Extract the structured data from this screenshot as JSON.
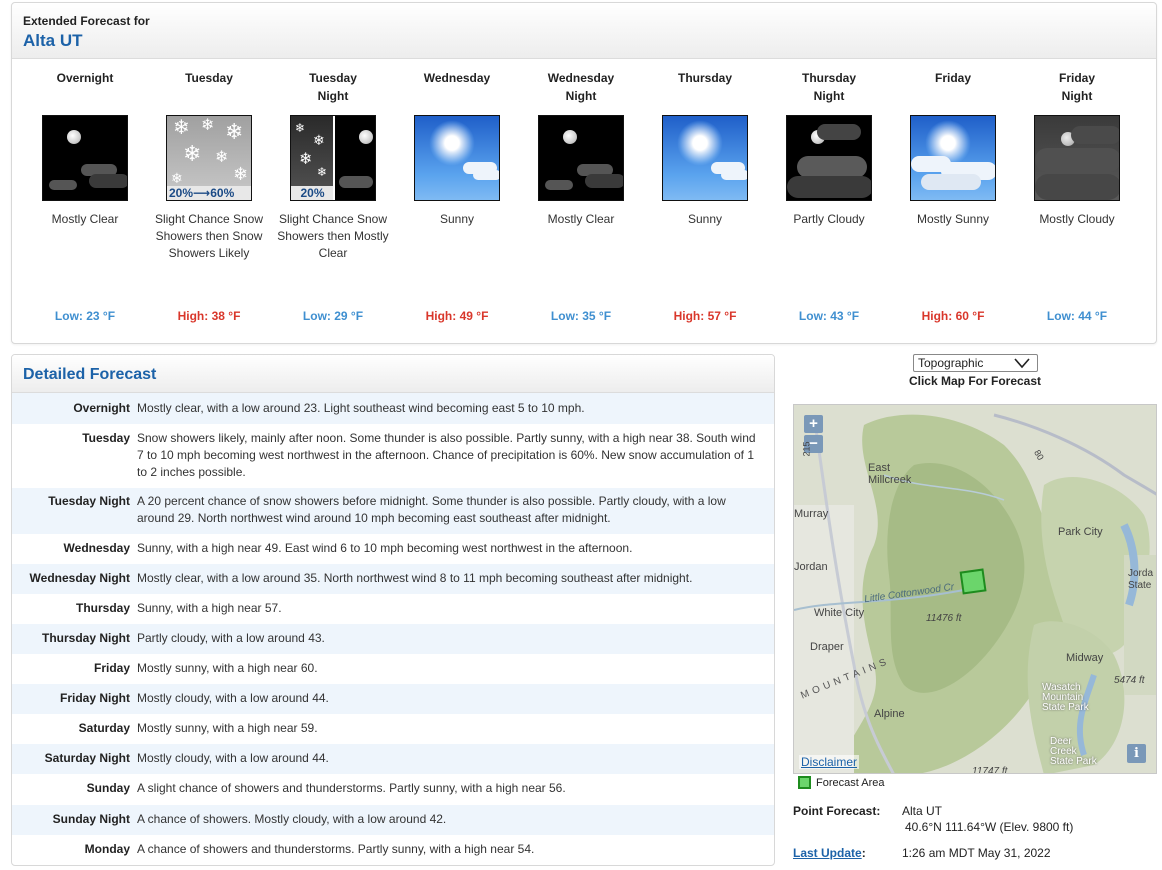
{
  "extended": {
    "subtitle": "Extended Forecast for",
    "location": "Alta UT",
    "periods": [
      {
        "name_line1": "Overnight",
        "name_line2": "",
        "short_desc": "Mostly Clear",
        "temp": "Low: 23 °F",
        "temp_type": "low",
        "icon": "night-clear-icon",
        "pop_label": ""
      },
      {
        "name_line1": "Tuesday",
        "name_line2": "",
        "short_desc": "Slight Chance Snow Showers then Snow Showers Likely",
        "temp": "High: 38 °F",
        "temp_type": "high",
        "icon": "snow-showers-icon",
        "pop_label": "20%⟶60%"
      },
      {
        "name_line1": "Tuesday",
        "name_line2": "Night",
        "short_desc": "Slight Chance Snow Showers then Mostly Clear",
        "temp": "Low: 29 °F",
        "temp_type": "low",
        "icon": "snow-then-clear-night-icon",
        "pop_label": "20%"
      },
      {
        "name_line1": "Wednesday",
        "name_line2": "",
        "short_desc": "Sunny",
        "temp": "High: 49 °F",
        "temp_type": "high",
        "icon": "sunny-icon",
        "pop_label": ""
      },
      {
        "name_line1": "Wednesday",
        "name_line2": "Night",
        "short_desc": "Mostly Clear",
        "temp": "Low: 35 °F",
        "temp_type": "low",
        "icon": "night-clear-icon",
        "pop_label": ""
      },
      {
        "name_line1": "Thursday",
        "name_line2": "",
        "short_desc": "Sunny",
        "temp": "High: 57 °F",
        "temp_type": "high",
        "icon": "sunny-icon",
        "pop_label": ""
      },
      {
        "name_line1": "Thursday",
        "name_line2": "Night",
        "short_desc": "Partly Cloudy",
        "temp": "Low: 43 °F",
        "temp_type": "low",
        "icon": "night-partly-cloudy-icon",
        "pop_label": ""
      },
      {
        "name_line1": "Friday",
        "name_line2": "",
        "short_desc": "Mostly Sunny",
        "temp": "High: 60 °F",
        "temp_type": "high",
        "icon": "mostly-sunny-icon",
        "pop_label": ""
      },
      {
        "name_line1": "Friday",
        "name_line2": "Night",
        "short_desc": "Mostly Cloudy",
        "temp": "Low: 44 °F",
        "temp_type": "low",
        "icon": "night-mostly-cloudy-icon",
        "pop_label": ""
      }
    ]
  },
  "detailed": {
    "title": "Detailed Forecast",
    "rows": [
      {
        "label": "Overnight",
        "text": "Mostly clear, with a low around 23. Light southeast wind becoming east 5 to 10 mph."
      },
      {
        "label": "Tuesday",
        "text": "Snow showers likely, mainly after noon. Some thunder is also possible. Partly sunny, with a high near 38. South wind 7 to 10 mph becoming west northwest in the afternoon. Chance of precipitation is 60%. New snow accumulation of 1 to 2 inches possible."
      },
      {
        "label": "Tuesday Night",
        "text": "A 20 percent chance of snow showers before midnight. Some thunder is also possible. Partly cloudy, with a low around 29. North northwest wind around 10 mph becoming east southeast after midnight."
      },
      {
        "label": "Wednesday",
        "text": "Sunny, with a high near 49. East wind 6 to 10 mph becoming west northwest in the afternoon."
      },
      {
        "label": "Wednesday Night",
        "text": "Mostly clear, with a low around 35. North northwest wind 8 to 11 mph becoming southeast after midnight."
      },
      {
        "label": "Thursday",
        "text": "Sunny, with a high near 57."
      },
      {
        "label": "Thursday Night",
        "text": "Partly cloudy, with a low around 43."
      },
      {
        "label": "Friday",
        "text": "Mostly sunny, with a high near 60."
      },
      {
        "label": "Friday Night",
        "text": "Mostly cloudy, with a low around 44."
      },
      {
        "label": "Saturday",
        "text": "Mostly sunny, with a high near 59."
      },
      {
        "label": "Saturday Night",
        "text": "Mostly cloudy, with a low around 44."
      },
      {
        "label": "Sunday",
        "text": "A slight chance of showers and thunderstorms. Partly sunny, with a high near 56."
      },
      {
        "label": "Sunday Night",
        "text": "A chance of showers. Mostly cloudy, with a low around 42."
      },
      {
        "label": "Monday",
        "text": "A chance of showers and thunderstorms. Partly sunny, with a high near 54."
      }
    ]
  },
  "map": {
    "type_select": "Topographic",
    "click_hint": "Click Map For Forecast",
    "zoom_in": "+",
    "zoom_out": "−",
    "labels": {
      "east_millcreek": "East\nMillcreek",
      "murray": "Murray",
      "jordan": "Jordan",
      "white_city": "White City",
      "draper": "Draper",
      "alpine": "Alpine",
      "park_city": "Park City",
      "jordanelle": "Jorda\nState",
      "midway": "Midway",
      "wasatch": "Wasatch\nMountain\nState Park",
      "deer_creek": "Deer\nCreek\nState Park",
      "little_cottonwood": "Little Cottonwood Cr",
      "elev_11476": "11476 ft",
      "elev_5474": "5474 ft",
      "elev_11747": "11747 ft",
      "mountains": "MOUNTAINS",
      "route_80": "80",
      "route_215": "215"
    },
    "disclaimer": "Disclaimer",
    "info": "i",
    "legend": "Forecast Area",
    "colors": {
      "forecast_area_fill": "#6bd56b",
      "forecast_area_stroke": "#1e8c1e"
    }
  },
  "point": {
    "label": "Point Forecast:",
    "name": "Alta UT",
    "coords": "40.6°N 111.64°W (Elev. 9800 ft)",
    "update_label": "Last Update",
    "update_sep": ":",
    "update_value": "1:26 am MDT May 31, 2022"
  }
}
